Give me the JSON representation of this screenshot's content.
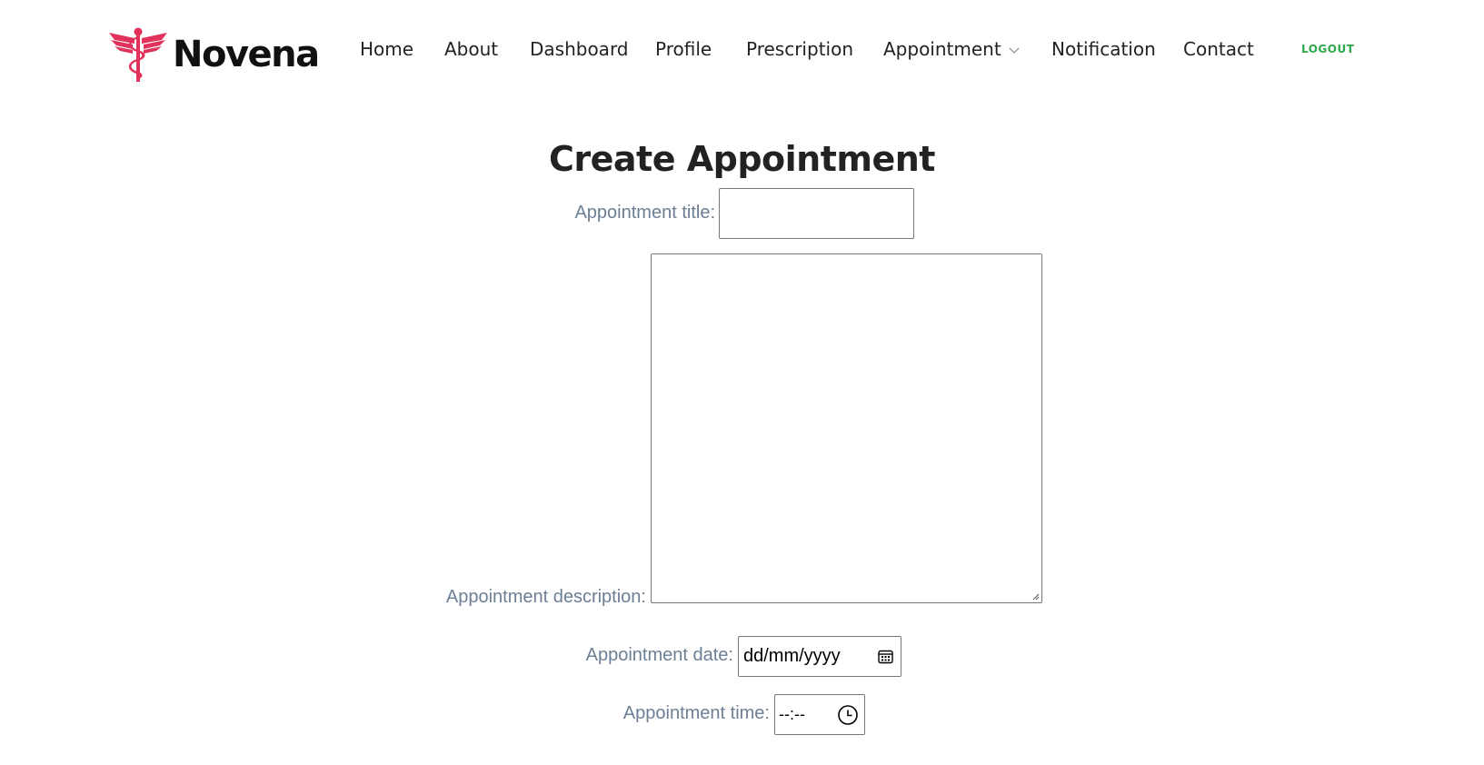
{
  "brand": {
    "name": "Novena",
    "icon": "caduceus-icon",
    "color": "#e0325a"
  },
  "nav": {
    "items": [
      {
        "label": "Home"
      },
      {
        "label": "About"
      },
      {
        "label": "Dashboard"
      },
      {
        "label": "Profile"
      },
      {
        "label": "Prescription"
      },
      {
        "label": "Appointment",
        "dropdown": true
      },
      {
        "label": "Notification"
      },
      {
        "label": "Contact"
      }
    ],
    "logout_label": "LOGOUT",
    "logout_color": "#2ea84a"
  },
  "form": {
    "heading": "Create Appointment",
    "title_label": "Appointment title:",
    "title_value": "",
    "description_label": "Appointment description:",
    "description_value": "",
    "date_label": "Appointment date:",
    "date_placeholder": "dd/mm/yyyy",
    "time_label": "Appointment time:",
    "time_placeholder": "--:--"
  }
}
